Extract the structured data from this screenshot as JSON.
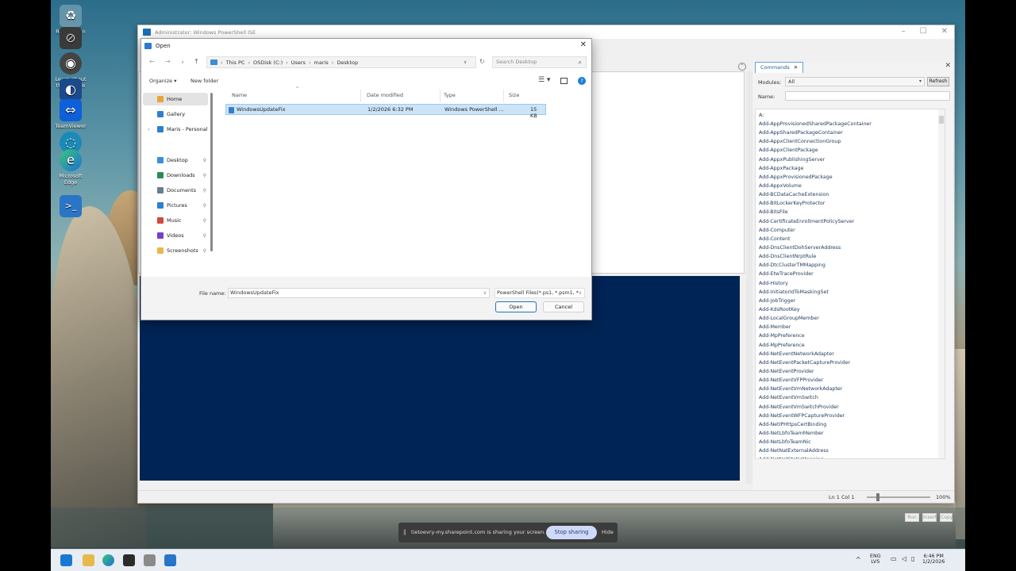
{
  "desktop": {
    "icons": [
      {
        "label": "Recycle Bin",
        "icon": "recycle-bin-icon"
      },
      {
        "label": "",
        "icon": "app-icon"
      },
      {
        "label": "Learn about this picture",
        "icon": "learn-about-picture-icon"
      },
      {
        "label": "TeamViewer",
        "icon": "teamviewer-icon"
      },
      {
        "label": "Microsoft Edge",
        "icon": "edge-icon"
      },
      {
        "label": "",
        "icon": "powershell-icon"
      }
    ]
  },
  "ise": {
    "title": "Administrator: Windows PowerShell ISE",
    "commands": {
      "tab_label": "Commands",
      "modules_label": "Modules:",
      "modules_value": "All",
      "refresh_label": "Refresh",
      "name_label": "Name:",
      "letter": "A:",
      "items": [
        "Add-AppProvisionedSharedPackageContainer",
        "Add-AppSharedPackageContainer",
        "Add-AppxClientConnectionGroup",
        "Add-AppxClientPackage",
        "Add-AppxPublishingServer",
        "Add-AppxPackage",
        "Add-AppxProvisionedPackage",
        "Add-AppxVolume",
        "Add-BCDataCacheExtension",
        "Add-BitLockerKeyProtector",
        "Add-BitsFile",
        "Add-CertificateEnrollmentPolicyServer",
        "Add-Computer",
        "Add-Content",
        "Add-DnsClientDohServerAddress",
        "Add-DnsClientNrptRule",
        "Add-DtcClusterTMMapping",
        "Add-EtwTraceProvider",
        "Add-History",
        "Add-InitiatorIdToMaskingSet",
        "Add-JobTrigger",
        "Add-KdsRootKey",
        "Add-LocalGroupMember",
        "Add-Member",
        "Add-MpPreference",
        "Add-MpPreference",
        "Add-NetEventNetworkAdapter",
        "Add-NetEventPacketCaptureProvider",
        "Add-NetEventProvider",
        "Add-NetEventVFPProvider",
        "Add-NetEventVmNetworkAdapter",
        "Add-NetEventVmSwitch",
        "Add-NetEventVmSwitchProvider",
        "Add-NetEventWFPCaptureProvider",
        "Add-NetIPHttpsCertBinding",
        "Add-NetLbfoTeamMember",
        "Add-NetLbfoTeamNic",
        "Add-NetNatExternalAddress",
        "Add-NetNatStaticMapping"
      ],
      "run_label": "Run",
      "insert_label": "Insert",
      "copy_label": "Copy"
    },
    "status": {
      "position": "Ln 1  Col 1",
      "zoom": "100%"
    }
  },
  "dialog": {
    "title": "Open",
    "breadcrumb": [
      "This PC",
      "OSDisk (C:)",
      "Users",
      "maris",
      "Desktop"
    ],
    "search_placeholder": "Search Desktop",
    "organize_label": "Organize",
    "new_folder_label": "New folder",
    "nav": [
      {
        "label": "Home",
        "icon": "home-icon",
        "color": "#e8a33c",
        "pinned": false
      },
      {
        "label": "Gallery",
        "icon": "gallery-icon",
        "color": "#2f7fd0",
        "pinned": false
      },
      {
        "label": "Maris - Personal",
        "icon": "onedrive-icon",
        "color": "#2f7fd0",
        "pinned": false
      },
      {
        "label": "Desktop",
        "icon": "desktop-folder-icon",
        "color": "#3b8fd8",
        "pinned": true
      },
      {
        "label": "Downloads",
        "icon": "downloads-icon",
        "color": "#2a8a5a",
        "pinned": true
      },
      {
        "label": "Documents",
        "icon": "documents-icon",
        "color": "#6a7c92",
        "pinned": true
      },
      {
        "label": "Pictures",
        "icon": "pictures-icon",
        "color": "#2f7fd0",
        "pinned": true
      },
      {
        "label": "Music",
        "icon": "music-icon",
        "color": "#d04a3a",
        "pinned": true
      },
      {
        "label": "Videos",
        "icon": "videos-icon",
        "color": "#7a3ec9",
        "pinned": true
      },
      {
        "label": "Screenshots",
        "icon": "folder-icon",
        "color": "#e8b84a",
        "pinned": true
      }
    ],
    "columns": {
      "name": "Name",
      "date": "Date modified",
      "type": "Type",
      "size": "Size"
    },
    "files": [
      {
        "name": "WindowsUpdateFix",
        "date": "1/2/2026 6:32 PM",
        "type": "Windows PowerShell ...",
        "size": "15 KB"
      }
    ],
    "file_name_label": "File name:",
    "file_name_value": "WindowsUpdateFix",
    "file_type_value": "PowerShell Files(*.ps1, *.psm1, *",
    "open_label": "Open",
    "cancel_label": "Cancel"
  },
  "sharing": {
    "message": "tietoevry-my.sharepoint.com is sharing your screen.",
    "stop_label": "Stop sharing",
    "hide_label": "Hide"
  },
  "taskbar": {
    "lang": "ENG",
    "lang_sub": "LVS",
    "time": "6:46 PM",
    "date": "1/2/2026"
  }
}
